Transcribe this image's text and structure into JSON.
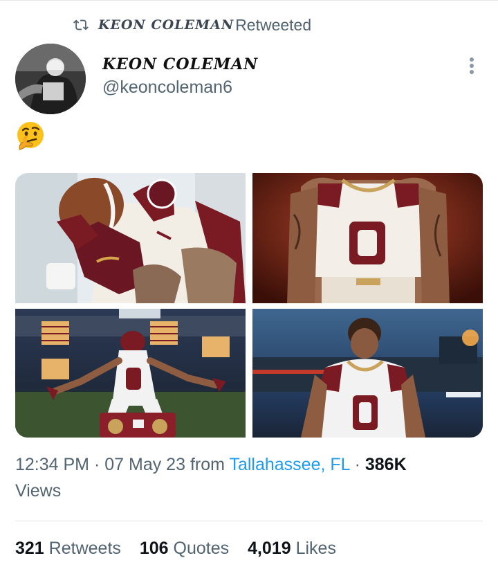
{
  "retweet": {
    "icon": "retweet-icon",
    "retweeter": "KEON COLEMAN",
    "suffix": "Retweeted"
  },
  "tweet": {
    "author": {
      "display_name": "KEON COLEMAN",
      "handle": "@keoncoleman6",
      "avatar": "avatar-photo"
    },
    "more_icon": "more-options-icon",
    "content_emoji": "thinking-face-emoji",
    "media": [
      {
        "name": "photo-football-glove",
        "colors": [
          "#e9eef1",
          "#6b1723",
          "#c9a25b"
        ]
      },
      {
        "name": "photo-jersey-zero-red",
        "colors": [
          "#7a2414",
          "#f3efe8",
          "#7a1a22"
        ]
      },
      {
        "name": "photo-stadium-boombox",
        "colors": [
          "#2f3b52",
          "#f2f2f2",
          "#7a1a22"
        ]
      },
      {
        "name": "photo-stadium-night",
        "colors": [
          "#2a4a6e",
          "#f2f2f2",
          "#7a1a22"
        ]
      }
    ],
    "time": "12:34 PM",
    "sep1": "·",
    "date": "07 May 23",
    "from_label": "from",
    "location": "Tallahassee, FL",
    "sep2": "·",
    "views_count": "386K",
    "views_label": "Views"
  },
  "stats": {
    "retweets_count": "321",
    "retweets_label": "Retweets",
    "quotes_count": "106",
    "quotes_label": "Quotes",
    "likes_count": "4,019",
    "likes_label": "Likes"
  },
  "colors": {
    "text_primary": "#0f1419",
    "text_secondary": "#536471",
    "link": "#1d9bf0",
    "fsu_garnet": "#782f40"
  }
}
